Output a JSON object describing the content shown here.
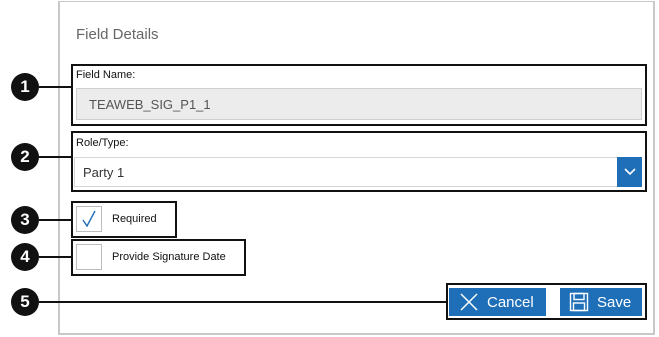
{
  "dialog": {
    "title": "Field Details"
  },
  "callouts": [
    "1",
    "2",
    "3",
    "4",
    "5"
  ],
  "field_name": {
    "label": "Field Name:",
    "value": "TEAWEB_SIG_P1_1"
  },
  "role_type": {
    "label": "Role/Type:",
    "selected": "Party 1"
  },
  "required": {
    "label": "Required",
    "checked": true
  },
  "signature_date": {
    "label": "Provide Signature Date",
    "checked": false
  },
  "actions": {
    "cancel_label": "Cancel",
    "save_label": "Save"
  },
  "colors": {
    "accent": "#1f6fb8",
    "callout": "#111111",
    "frame": "#111111"
  }
}
